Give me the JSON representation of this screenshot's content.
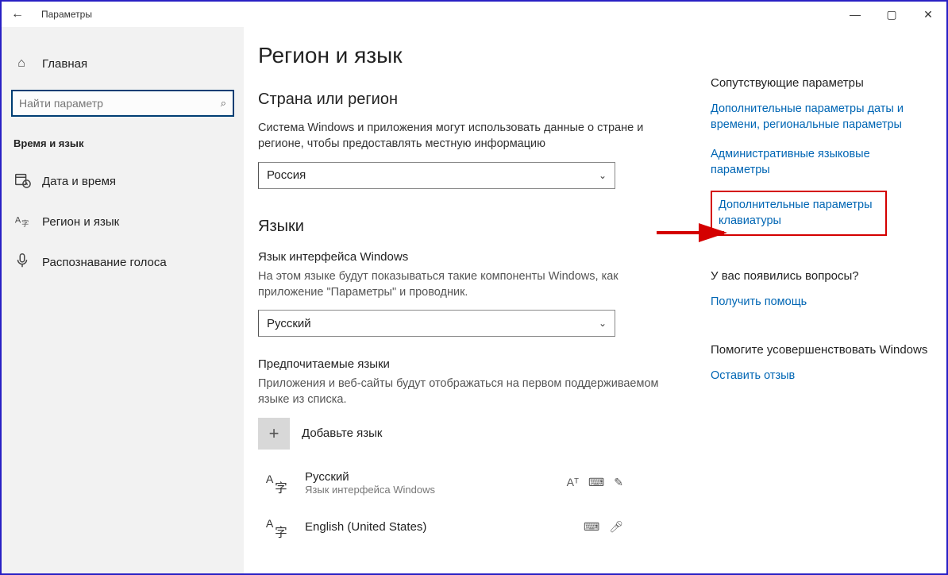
{
  "titlebar": {
    "title": "Параметры"
  },
  "sidebar": {
    "home": "Главная",
    "search_placeholder": "Найти параметр",
    "section": "Время и язык",
    "items": [
      {
        "label": "Дата и время"
      },
      {
        "label": "Регион и язык"
      },
      {
        "label": "Распознавание голоса"
      }
    ]
  },
  "content": {
    "page_title": "Регион и язык",
    "region_heading": "Страна или регион",
    "region_desc": "Система Windows и приложения могут использовать данные о стране и регионе, чтобы предоставлять местную информацию",
    "region_value": "Россия",
    "lang_heading": "Языки",
    "displaylang_sub": "Язык интерфейса Windows",
    "displaylang_desc": "На этом языке будут показываться такие компоненты Windows, как приложение \"Параметры\" и проводник.",
    "displaylang_value": "Русский",
    "preferred_sub": "Предпочитаемые языки",
    "preferred_desc": "Приложения и веб-сайты будут отображаться на первом поддерживаемом языке из списка.",
    "add_lang": "Добавьте язык",
    "lang1": {
      "title": "Русский",
      "sub": "Язык интерфейса Windows"
    },
    "lang2": {
      "title": "English (United States)",
      "sub": ""
    }
  },
  "right": {
    "head1": "Сопутствующие параметры",
    "link1": "Дополнительные параметры даты и времени, региональные параметры",
    "link2": "Административные языковые параметры",
    "link3": "Дополнительные параметры клавиатуры",
    "head2": "У вас появились вопросы?",
    "link4": "Получить помощь",
    "head3": "Помогите усовершенствовать Windows",
    "link5": "Оставить отзыв"
  }
}
